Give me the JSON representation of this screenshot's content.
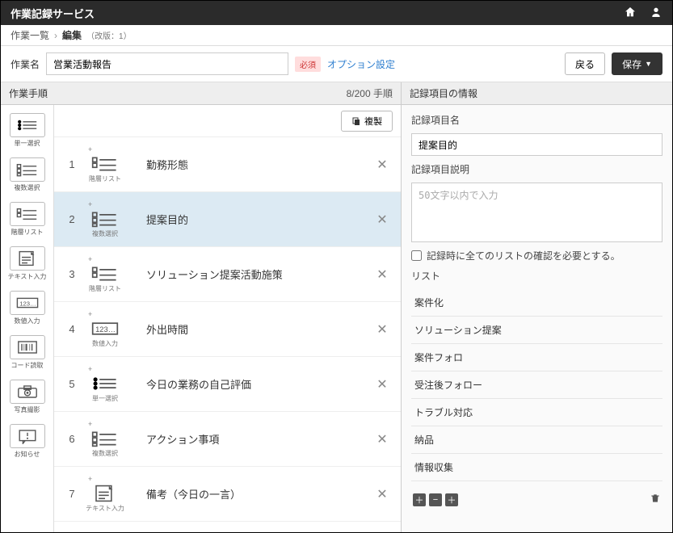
{
  "topbar": {
    "title": "作業記録サービス"
  },
  "breadcrumb": {
    "list": "作業一覧",
    "edit": "編集",
    "rev": "（改版：1）"
  },
  "name": {
    "label": "作業名",
    "value": "営業活動報告",
    "required_badge": "必須",
    "option_link": "オプション設定",
    "back": "戻る",
    "save": "保存"
  },
  "steps_header": {
    "title": "作業手順",
    "count": "8/200 手順"
  },
  "copy_btn": "複製",
  "palette": [
    {
      "key": "single",
      "label": "単一選択"
    },
    {
      "key": "multi",
      "label": "複数選択"
    },
    {
      "key": "layer",
      "label": "階層リスト"
    },
    {
      "key": "text",
      "label": "テキスト入力"
    },
    {
      "key": "number",
      "label": "数値入力"
    },
    {
      "key": "barcode",
      "label": "コード読取"
    },
    {
      "key": "photo",
      "label": "写真撮影"
    },
    {
      "key": "notice",
      "label": "お知らせ"
    }
  ],
  "steps": [
    {
      "num": "1",
      "type": "階層リスト",
      "title": "勤務形態",
      "icon": "layer"
    },
    {
      "num": "2",
      "type": "複数選択",
      "title": "提案目的",
      "icon": "multi",
      "selected": true
    },
    {
      "num": "3",
      "type": "階層リスト",
      "title": "ソリューション提案活動施策",
      "icon": "layer"
    },
    {
      "num": "4",
      "type": "数値入力",
      "title": "外出時間",
      "icon": "number"
    },
    {
      "num": "5",
      "type": "単一選択",
      "title": "今日の業務の自己評価",
      "icon": "single"
    },
    {
      "num": "6",
      "type": "複数選択",
      "title": "アクション事項",
      "icon": "multi"
    },
    {
      "num": "7",
      "type": "テキスト入力",
      "title": "備考（今日の一言）",
      "icon": "text"
    }
  ],
  "right": {
    "header": "記録項目の情報",
    "name_label": "記録項目名",
    "name_value": "提案目的",
    "desc_label": "記録項目説明",
    "desc_placeholder": "50文字以内で入力",
    "chk_label": "記録時に全てのリストの確認を必要とする。",
    "list_label": "リスト",
    "list": [
      "案件化",
      "ソリューション提案",
      "案件フォロ",
      "受注後フォロー",
      "トラブル対応",
      "納品",
      "情報収集"
    ]
  }
}
